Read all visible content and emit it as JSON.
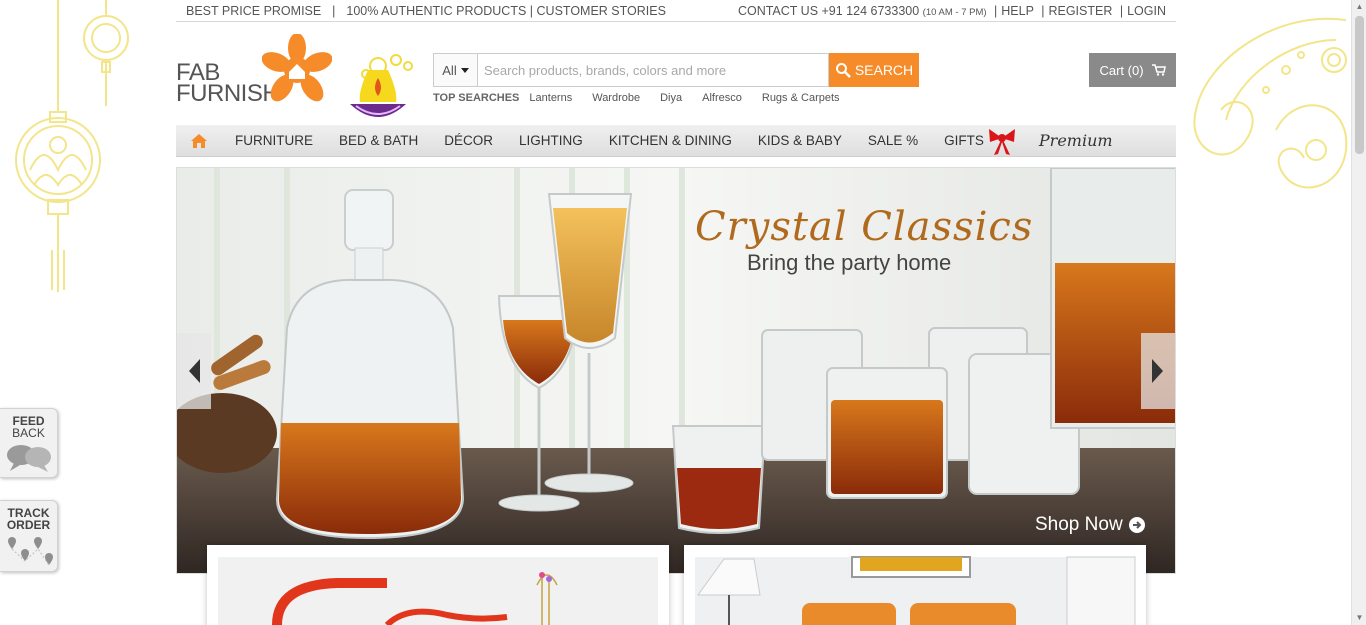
{
  "topbar": {
    "best_price": "BEST PRICE PROMISE",
    "authentic": "100% AUTHENTIC PRODUCTS",
    "stories": "CUSTOMER STORIES",
    "contact": "CONTACT US +91 124 6733300",
    "hours": "(10 AM - 7 PM)",
    "help": "HELP",
    "register": "REGISTER",
    "login": "LOGIN"
  },
  "logo": {
    "line1": "FAB",
    "line2": "FURNISH"
  },
  "search": {
    "category": "All",
    "placeholder": "Search products, brands, colors and more",
    "button": "SEARCH"
  },
  "top_searches": {
    "label": "TOP SEARCHES",
    "items": [
      "Lanterns",
      "Wardrobe",
      "Diya",
      "Alfresco",
      "Rugs & Carpets"
    ]
  },
  "cart": {
    "label": "Cart (0)"
  },
  "nav": {
    "items": [
      "FURNITURE",
      "BED & BATH",
      "DÉCOR",
      "LIGHTING",
      "KITCHEN & DINING",
      "KIDS & BABY",
      "SALE %",
      "GIFTS"
    ],
    "premium": "Premium"
  },
  "hero": {
    "title": "Crystal Classics",
    "subtitle": "Bring the party home",
    "cta": "Shop Now"
  },
  "side": {
    "feedback_line1": "FEED",
    "feedback_line2": "BACK",
    "track_line1": "TRACK",
    "track_line2": "ORDER"
  },
  "colors": {
    "accent_orange": "#f68b2a",
    "cart_gray": "#8a8a8a",
    "deco_yellow": "#f3e58a"
  }
}
